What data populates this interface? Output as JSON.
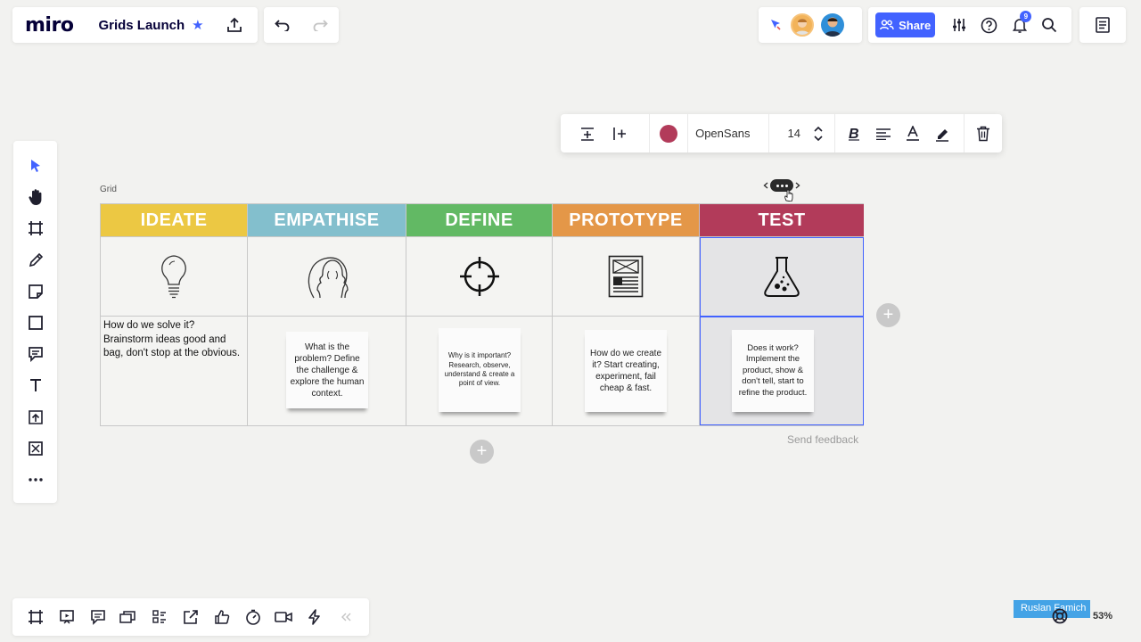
{
  "app": {
    "logo": "miro",
    "board_title": "Grids Launch"
  },
  "toolbar": {
    "share_label": "Share",
    "notifications_count": "9"
  },
  "context_toolbar": {
    "color": "#b23b5a",
    "font_name": "OpenSans",
    "font_size": "14"
  },
  "grid": {
    "label": "Grid",
    "columns": [
      {
        "title": "IDEATE",
        "color": "#ecc843",
        "icon": "lightbulb-icon",
        "text": "How do we solve it? Brainstorm ideas good and bag, don't stop at the obvious."
      },
      {
        "title": "EMPATHISE",
        "color": "#83bfcd",
        "icon": "head-icon",
        "text": "What is the problem? Define the challenge & explore the human context."
      },
      {
        "title": "DEFINE",
        "color": "#62b964",
        "icon": "target-icon",
        "text": "Why is it important? Research, observe, understand & create a point of view."
      },
      {
        "title": "PROTOTYPE",
        "color": "#e49748",
        "icon": "document-icon",
        "text": "How do we create it? Start creating, experiment, fail cheap & fast."
      },
      {
        "title": "TEST",
        "color": "#b23b5a",
        "icon": "flask-icon",
        "text": "Does it work? Implement the product, show & don't tell, start to refine the product."
      }
    ]
  },
  "feedback_label": "Send feedback",
  "collaborator_tag": "Ruslan Famich",
  "zoom_level": "53%"
}
